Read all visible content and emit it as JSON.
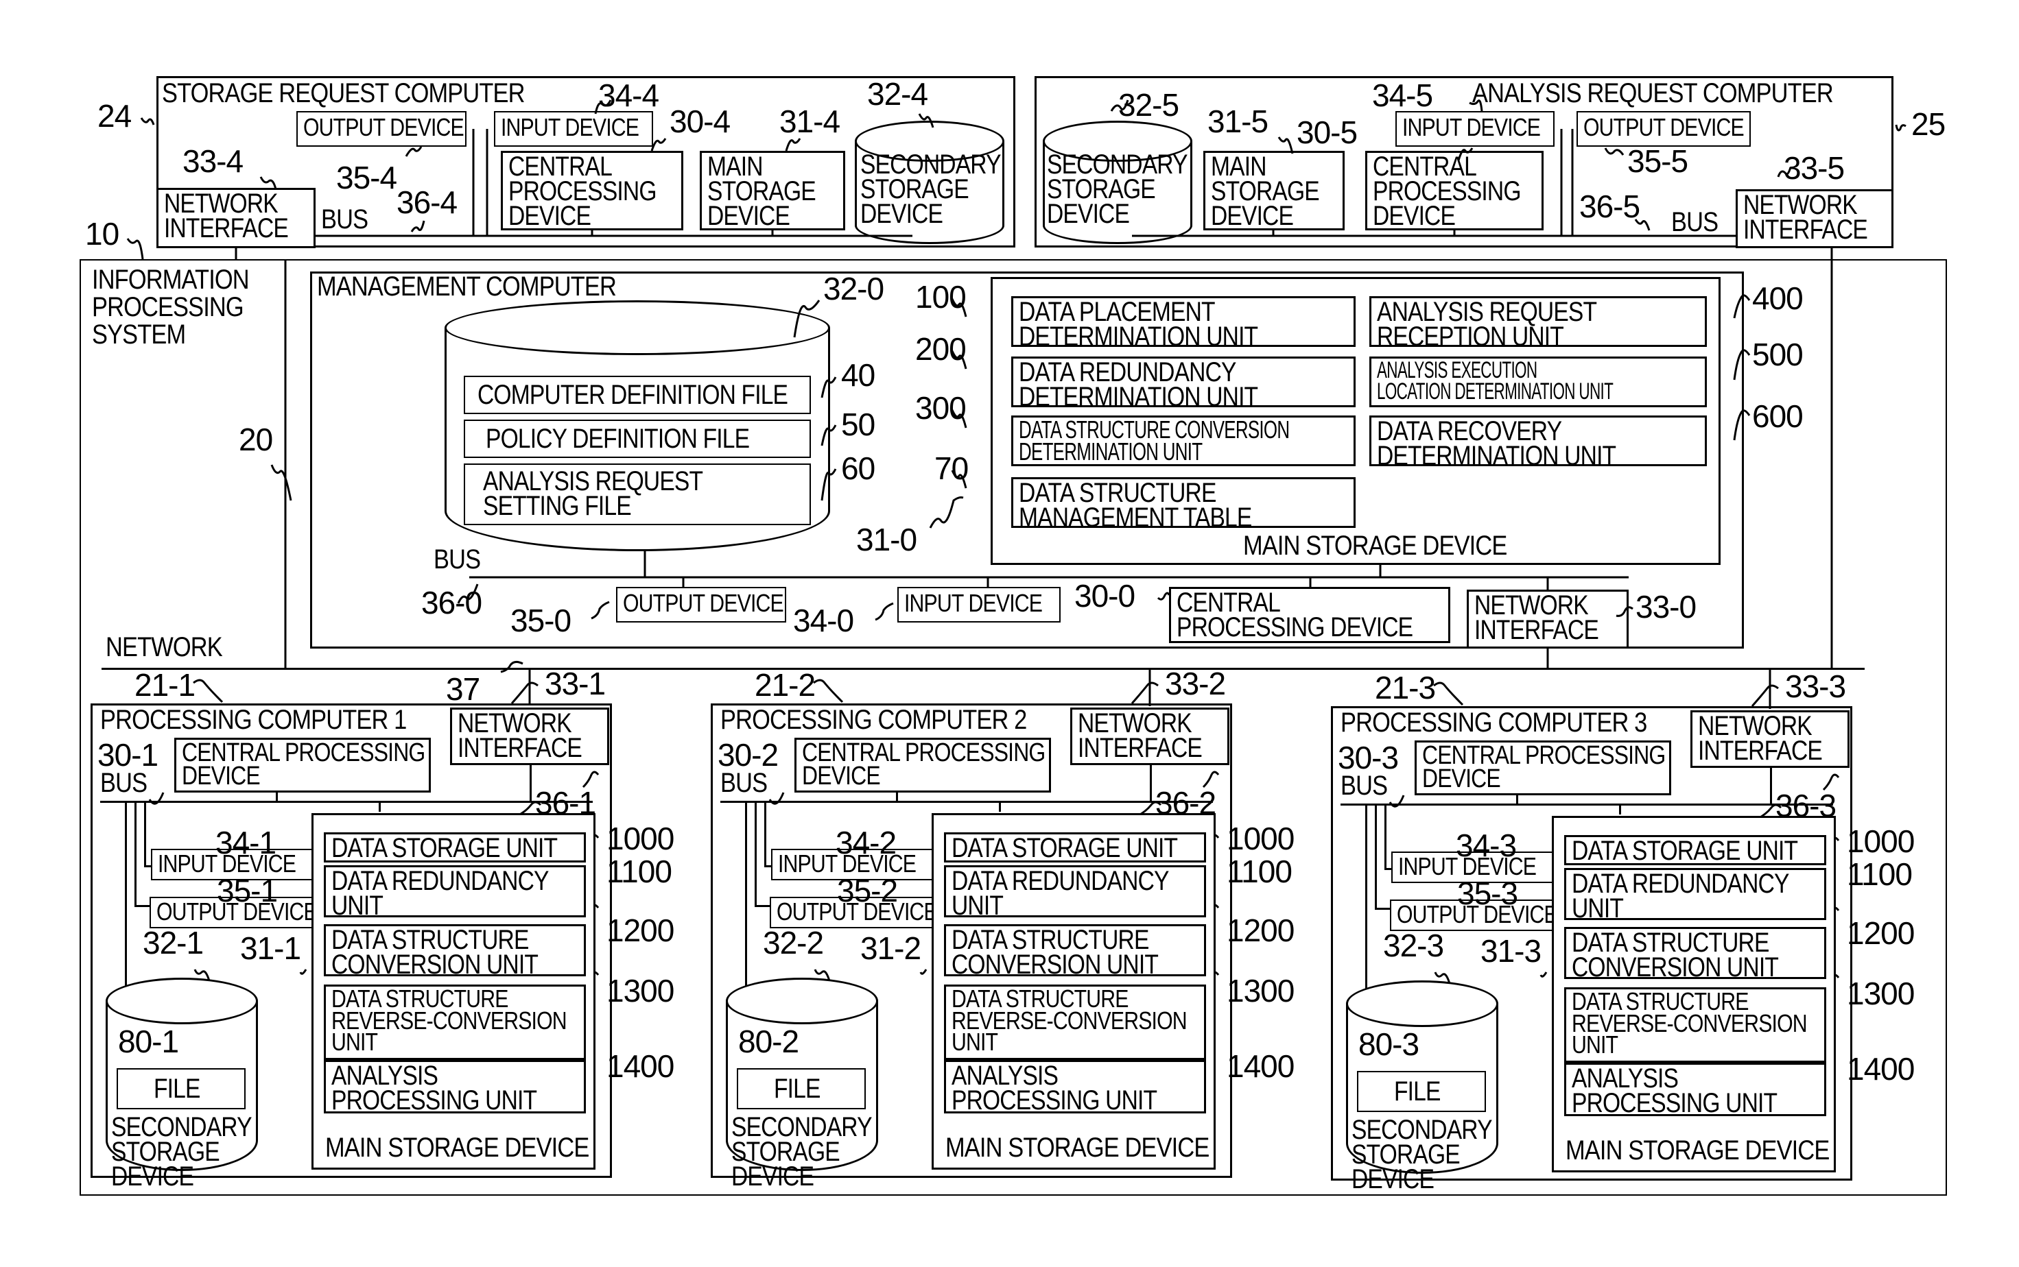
{
  "figure": {
    "system": {
      "ref": "10",
      "label": "INFORMATION\nPROCESSING\nSYSTEM"
    },
    "network": {
      "label": "NETWORK",
      "ref": "37"
    },
    "storage_request_computer": {
      "ref": "24",
      "title": "STORAGE REQUEST COMPUTER",
      "output_device": {
        "label": "OUTPUT DEVICE",
        "ref": "35-4"
      },
      "input_device": {
        "label": "INPUT DEVICE",
        "ref": "34-4"
      },
      "cpu": {
        "label": "CENTRAL\nPROCESSING\nDEVICE",
        "ref": "30-4"
      },
      "main_storage": {
        "label": "MAIN\nSTORAGE\nDEVICE",
        "ref": "31-4"
      },
      "secondary_storage": {
        "label": "SECONDARY\nSTORAGE\nDEVICE",
        "ref": "32-4"
      },
      "network_interface": {
        "label": "NETWORK\nINTERFACE",
        "ref": "33-4"
      },
      "bus": {
        "label": "BUS",
        "ref": "36-4"
      }
    },
    "analysis_request_computer": {
      "ref": "25",
      "title": "ANALYSIS REQUEST COMPUTER",
      "output_device": {
        "label": "OUTPUT DEVICE",
        "ref": "35-5"
      },
      "input_device": {
        "label": "INPUT DEVICE",
        "ref": "34-5"
      },
      "cpu": {
        "label": "CENTRAL\nPROCESSING\nDEVICE",
        "ref": "30-5"
      },
      "main_storage": {
        "label": "MAIN\nSTORAGE\nDEVICE",
        "ref": "31-5"
      },
      "secondary_storage": {
        "label": "SECONDARY\nSTORAGE\nDEVICE",
        "ref": "32-5"
      },
      "network_interface": {
        "label": "NETWORK\nINTERFACE",
        "ref": "33-5"
      },
      "bus": {
        "label": "BUS",
        "ref": "36-5"
      }
    },
    "management_computer": {
      "ref": "20",
      "title": "MANAGEMENT COMPUTER",
      "secondary_storage": {
        "ref": "32-0",
        "files": [
          {
            "label": "COMPUTER DEFINITION FILE",
            "ref": "40"
          },
          {
            "label": "POLICY DEFINITION FILE",
            "ref": "50"
          },
          {
            "label": "ANALYSIS REQUEST\nSETTING FILE",
            "ref": "60"
          }
        ]
      },
      "main_storage": {
        "ref": "31-0",
        "label": "MAIN STORAGE DEVICE",
        "units_left": [
          {
            "label": "DATA PLACEMENT\nDETERMINATION UNIT",
            "ref": "100"
          },
          {
            "label": "DATA REDUNDANCY\nDETERMINATION UNIT",
            "ref": "200"
          },
          {
            "label": "DATA STRUCTURE CONVERSION\nDETERMINATION UNIT",
            "ref": "300"
          },
          {
            "label": "DATA STRUCTURE\nMANAGEMENT TABLE",
            "ref": "70"
          }
        ],
        "units_right": [
          {
            "label": "ANALYSIS REQUEST\nRECEPTION UNIT",
            "ref": "400"
          },
          {
            "label": "ANALYSIS EXECUTION\nLOCATION DETERMINATION UNIT",
            "ref": "500"
          },
          {
            "label": "DATA RECOVERY\nDETERMINATION UNIT",
            "ref": "600"
          }
        ]
      },
      "bus": {
        "label": "BUS",
        "ref": "36-0"
      },
      "output_device": {
        "label": "OUTPUT DEVICE",
        "ref": "35-0"
      },
      "input_device": {
        "label": "INPUT DEVICE",
        "ref": "34-0"
      },
      "cpu": {
        "label": "CENTRAL\nPROCESSING DEVICE",
        "ref": "30-0"
      },
      "network_interface": {
        "label": "NETWORK\nINTERFACE",
        "ref": "33-0"
      }
    },
    "processing_computers": [
      {
        "ref": "21-1",
        "title": "PROCESSING COMPUTER 1",
        "cpu": {
          "label": "CENTRAL PROCESSING\nDEVICE",
          "ref": "30-1"
        },
        "bus": {
          "label": "BUS",
          "ref": "36-1"
        },
        "network_interface": {
          "label": "NETWORK\nINTERFACE",
          "ref": "33-1"
        },
        "input_device": {
          "label": "INPUT DEVICE",
          "ref": "34-1"
        },
        "output_device": {
          "label": "OUTPUT DEVICE",
          "ref": "35-1"
        },
        "secondary_storage": {
          "label": "SECONDARY\nSTORAGE\nDEVICE",
          "ref": "32-1",
          "file": {
            "label": "FILE",
            "ref": "80-1"
          }
        },
        "main_storage": {
          "label": "MAIN STORAGE DEVICE",
          "ref": "31-1"
        }
      },
      {
        "ref": "21-2",
        "title": "PROCESSING COMPUTER 2",
        "cpu": {
          "label": "CENTRAL PROCESSING\nDEVICE",
          "ref": "30-2"
        },
        "bus": {
          "label": "BUS",
          "ref": "36-2"
        },
        "network_interface": {
          "label": "NETWORK\nINTERFACE",
          "ref": "33-2"
        },
        "input_device": {
          "label": "INPUT DEVICE",
          "ref": "34-2"
        },
        "output_device": {
          "label": "OUTPUT DEVICE",
          "ref": "35-2"
        },
        "secondary_storage": {
          "label": "SECONDARY\nSTORAGE\nDEVICE",
          "ref": "32-2",
          "file": {
            "label": "FILE",
            "ref": "80-2"
          }
        },
        "main_storage": {
          "label": "MAIN STORAGE DEVICE",
          "ref": "31-2"
        }
      },
      {
        "ref": "21-3",
        "title": "PROCESSING COMPUTER 3",
        "cpu": {
          "label": "CENTRAL PROCESSING\nDEVICE",
          "ref": "30-3"
        },
        "bus": {
          "label": "BUS",
          "ref": "36-3"
        },
        "network_interface": {
          "label": "NETWORK\nINTERFACE",
          "ref": "33-3"
        },
        "input_device": {
          "label": "INPUT DEVICE",
          "ref": "34-3"
        },
        "output_device": {
          "label": "OUTPUT DEVICE",
          "ref": "35-3"
        },
        "secondary_storage": {
          "label": "SECONDARY\nSTORAGE\nDEVICE",
          "ref": "32-3",
          "file": {
            "label": "FILE",
            "ref": "80-3"
          }
        },
        "main_storage": {
          "label": "MAIN STORAGE DEVICE",
          "ref": "31-3"
        }
      }
    ],
    "processing_units": [
      {
        "label": "DATA STORAGE UNIT",
        "ref": "1000"
      },
      {
        "label": "DATA REDUNDANCY\nUNIT",
        "ref": "1100"
      },
      {
        "label": "DATA STRUCTURE\nCONVERSION UNIT",
        "ref": "1200"
      },
      {
        "label": "DATA STRUCTURE\nREVERSE-CONVERSION\nUNIT",
        "ref": "1300"
      },
      {
        "label": "ANALYSIS\nPROCESSING UNIT",
        "ref": "1400"
      }
    ]
  }
}
